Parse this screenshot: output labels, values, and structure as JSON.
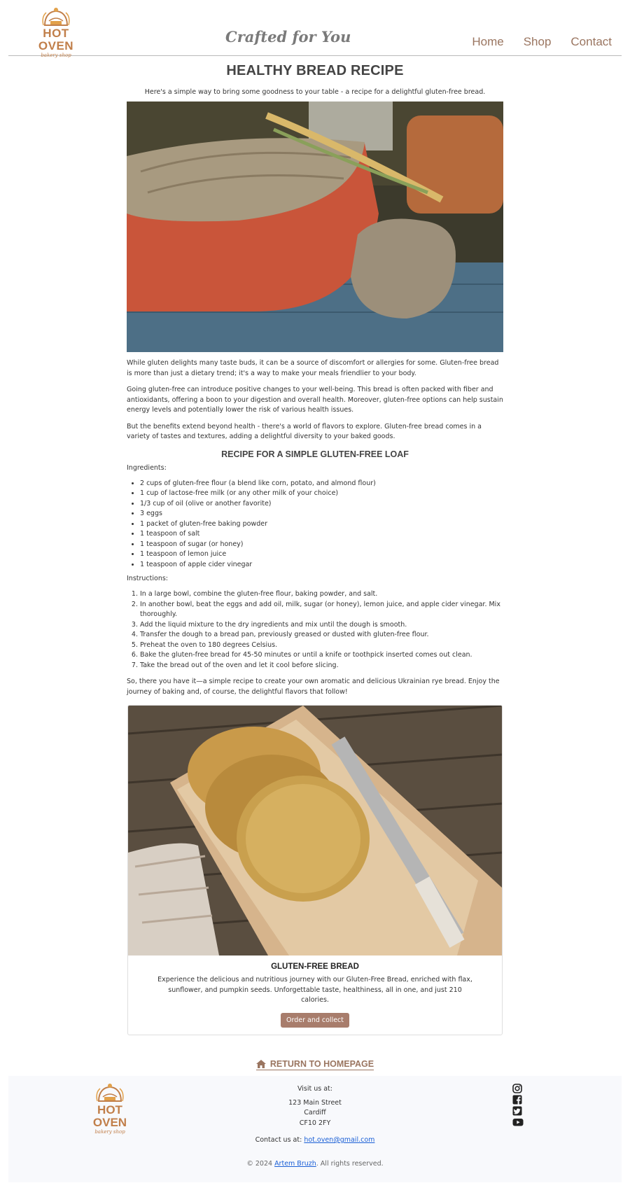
{
  "brand": {
    "name": "HOT OVEN",
    "sub": "bakery shop"
  },
  "tagline": "Crafted for You",
  "nav": [
    {
      "label": "Home"
    },
    {
      "label": "Shop"
    },
    {
      "label": "Contact"
    }
  ],
  "page": {
    "title": "HEALTHY BREAD RECIPE",
    "intro": "Here's a simple way to bring some goodness to your table - a recipe for a delightful gluten-free bread.",
    "paragraphs": [
      "While gluten delights many taste buds, it can be a source of discomfort or allergies for some. Gluten-free bread is more than just a dietary trend; it's a way to make your meals friendlier to your body.",
      "Going gluten-free can introduce positive changes to your well-being. This bread is often packed with fiber and antioxidants, offering a boon to your digestion and overall health. Moreover, gluten-free options can help sustain energy levels and potentially lower the risk of various health issues.",
      "But the benefits extend beyond health - there's a world of flavors to explore. Gluten-free bread comes in a variety of tastes and textures, adding a delightful diversity to your baked goods."
    ],
    "recipe_title": "RECIPE FOR A SIMPLE GLUTEN-FREE LOAF",
    "ingredients_label": "Ingredients:",
    "ingredients": [
      "2 cups of gluten-free flour (a blend like corn, potato, and almond flour)",
      "1 cup of lactose-free milk (or any other milk of your choice)",
      "1/3 cup of oil (olive or another favorite)",
      "3 eggs",
      "1 packet of gluten-free baking powder",
      "1 teaspoon of salt",
      "1 teaspoon of sugar (or honey)",
      "1 teaspoon of lemon juice",
      "1 teaspoon of apple cider vinegar"
    ],
    "instructions_label": "Instructions:",
    "instructions": [
      "In a large bowl, combine the gluten-free flour, baking powder, and salt.",
      "In another bowl, beat the eggs and add oil, milk, sugar (or honey), lemon juice, and apple cider vinegar. Mix thoroughly.",
      "Add the liquid mixture to the dry ingredients and mix until the dough is smooth.",
      "Transfer the dough to a bread pan, previously greased or dusted with gluten-free flour.",
      "Preheat the oven to 180 degrees Celsius.",
      "Bake the gluten-free bread for 45-50 minutes or until a knife or toothpick inserted comes out clean.",
      "Take the bread out of the oven and let it cool before slicing."
    ],
    "outro": "So, there you have it—a simple recipe to create your own aromatic and delicious Ukrainian rye bread. Enjoy the journey of baking and, of course, the delightful flavors that follow!"
  },
  "product": {
    "title": "GLUTEN-FREE BREAD",
    "description": "Experience the delicious and nutritious journey with our Gluten-Free Bread, enriched with flax, sunflower, and pumpkin seeds. Unforgettable taste, healthiness, all in one, and just 210 calories.",
    "button": "Order and collect"
  },
  "return_link": "RETURN TO HOMEPAGE",
  "footer": {
    "visit_label": "Visit us at:",
    "address": [
      "123 Main Street",
      "Cardiff",
      "CF10 2FY"
    ],
    "contact_prefix": "Contact us at: ",
    "email": "hot.oven@gmail.com",
    "copyright_prefix": "© 2024 ",
    "author": "Artem Bruzh",
    "copyright_suffix": ". All rights reserved.",
    "socials": [
      "instagram-icon",
      "facebook-icon",
      "twitter-icon",
      "youtube-icon"
    ]
  },
  "colors": {
    "brand": "#c17f4a",
    "accent": "#9a7560",
    "button": "#a87d6c",
    "footer_bg": "#f8f9fc"
  }
}
